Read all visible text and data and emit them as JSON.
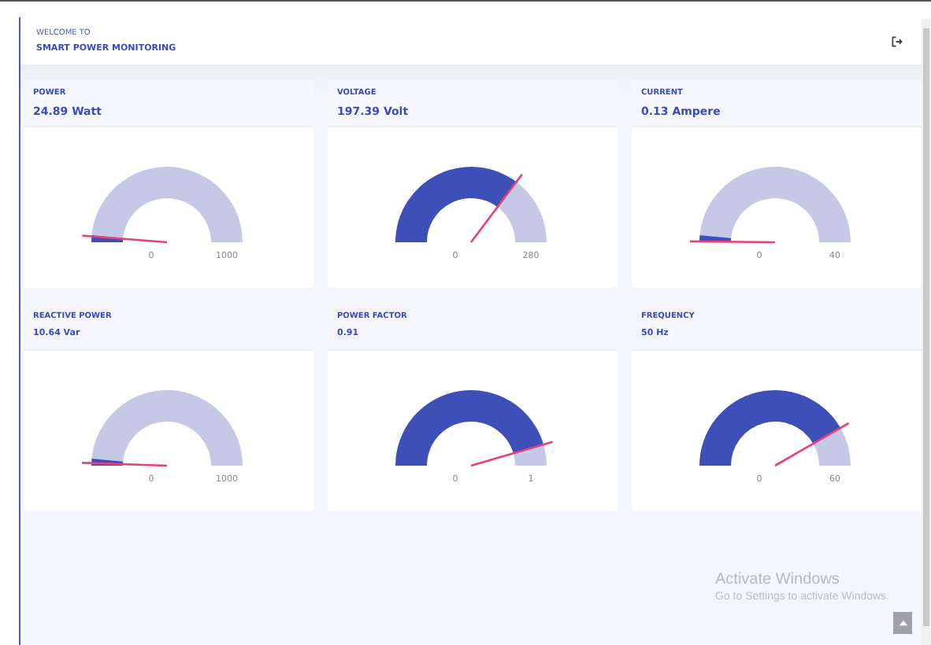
{
  "header": {
    "greeting": "WELCOME TO",
    "title": "SMART POWER MONITORING"
  },
  "gauges": [
    {
      "title": "POWER",
      "value": "24.89 Watt",
      "min": "0",
      "max": "1000"
    },
    {
      "title": "VOLTAGE",
      "value": "197.39 Volt",
      "min": "0",
      "max": "280"
    },
    {
      "title": "CURRENT",
      "value": "0.13 Ampere",
      "min": "0",
      "max": "40"
    },
    {
      "title": "REACTIVE POWER",
      "value": "10.64 Var",
      "min": "0",
      "max": "1000"
    },
    {
      "title": "POWER FACTOR",
      "value": "0.91",
      "min": "0",
      "max": "1"
    },
    {
      "title": "FREQUENCY",
      "value": "50 Hz",
      "min": "0",
      "max": "60"
    }
  ],
  "activation_notice": {
    "title": "Activate Windows",
    "subtitle": "Go to Settings to activate Windows."
  }
}
